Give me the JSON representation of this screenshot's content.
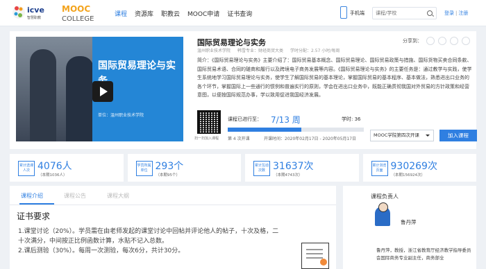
{
  "header": {
    "logo_icve_label": "智慧职教",
    "logo_mooc_label": "MOOC COLLEGE",
    "nav": [
      "课程",
      "资源库",
      "职教云",
      "MOOC申请",
      "证书查询"
    ],
    "mobile_label": "手机端",
    "search_placeholder": "课程/学校",
    "login_label": "登录",
    "register_label": "注册"
  },
  "course": {
    "title": "国际贸易理论与实务",
    "cover_title": "国际贸易理论与实务",
    "cover_unit": "单位：温州职业技术学院",
    "meta": [
      "温州职业技术学院",
      "韩雪专业：财经商贸大类",
      "学时分配：2.57 小时/每周"
    ],
    "share_label": "分享到：",
    "intro": "简介：《国际贸易理论与实务》主要介绍了：国际贸易基本概念、国际贸易理论、国际贸易政策与措施、国际货物买卖合同条款、国际贸易术语、合同的磋商和履行以及跨境电子商务发展等内容。《国际贸易理论与实务》的主要任务是：通过教学与实践，使学生系统地学习国际贸易理论与实务，使学生了解国际贸易的基本理论，掌握国际贸易的基本程序、基本做法，熟悉进出口业务的各个环节，掌握国际上一些通行的惯例和普遍实行的原则，学会在进出口业务中，既能正确贯彻我国对外贸易的方针政策和经营意图，以便按国际规范办事，学以致用促进我国经济发展。",
    "qr_caption": "扫一扫加入课程",
    "progress_label": "课程已进行至：",
    "progress_value": "7/13 周",
    "progress_fraction": 0.54,
    "hours_label": "学时: 36",
    "term_label": "第 4 次开课",
    "dates_label": "开课时间：2020年02月17日 - 2020年05月17日",
    "term_select": "MOOC学院第四次开课",
    "join_label": "加入课程"
  },
  "stats": [
    {
      "tag": "累计选课人次",
      "value": "4076人",
      "sub": "（本期1036人）"
    },
    {
      "tag": "学员所属单位",
      "value": "293个",
      "sub": "（本期95个）"
    },
    {
      "tag": "累计互动次数",
      "value": "31637次",
      "sub": "（本期4743次）"
    },
    {
      "tag": "累计浏览页面",
      "value": "930269次",
      "sub": "（本期156924次）"
    }
  ],
  "tabs": [
    "课程介绍",
    "课程公告",
    "课程大纲"
  ],
  "content": {
    "heading": "证书要求",
    "paragraph": "1.课堂讨论（20%）。学员需在由老师发起的课堂讨论中回帖并评论他人的帖子，十次及格，二十次满分，中间按正比例函数计算，水贴不记入总数。",
    "paragraph2": "2.课后测验（30%）。每周一次测验，每次6分，共计30分。"
  },
  "teacher": {
    "section_title": "课程负责人",
    "name": "鲁丹萍",
    "bio": "鲁丹萍，教授，浙江省教育厅经济教学指导委员会国际商务专业副主任，商务部全"
  }
}
